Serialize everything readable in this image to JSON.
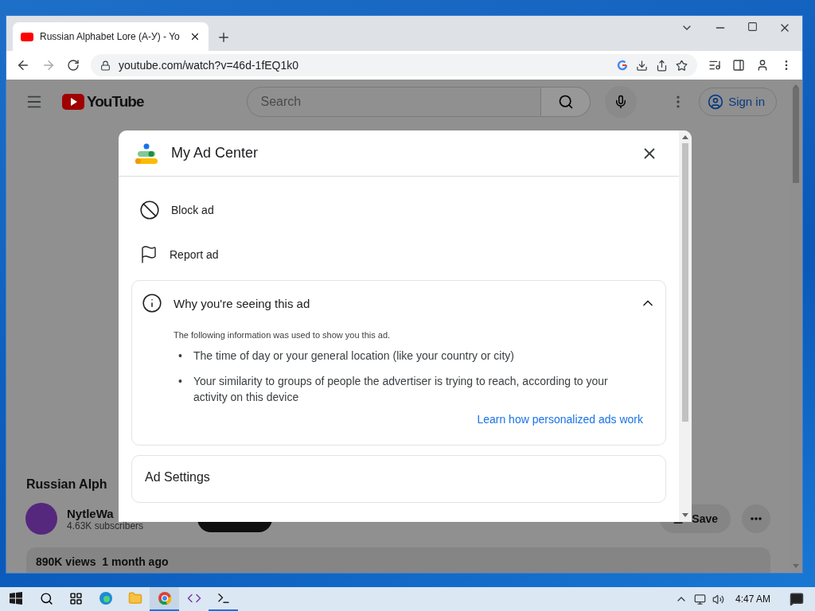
{
  "window": {
    "tab": {
      "title": "Russian Alphabet Lore (А-У) - Yo",
      "selected": true
    },
    "address": "youtube.com/watch?v=46d-1fEQ1k0"
  },
  "youtube": {
    "logo": "YouTube",
    "search": {
      "placeholder": "Search"
    },
    "sign_in": "Sign in",
    "video_title": "Russian Alph",
    "channel": {
      "name": "NytleWa",
      "subscribers": "4.63K subscribers"
    },
    "actions": [
      "Save"
    ],
    "description": "890K views  1 month ago"
  },
  "dialog": {
    "title": "My Ad Center",
    "items": [
      {
        "kind": "block",
        "label": "Block ad"
      },
      {
        "kind": "report",
        "label": "Report ad"
      }
    ],
    "why": {
      "title": "Why you're seeing this ad",
      "expanded": true,
      "intro": "The following information was used to show you this ad.",
      "bullets": [
        {
          "marker": "•",
          "text": "The time of day or your general location (like your country or city)"
        },
        {
          "marker": "•",
          "text": "Your similarity to groups of people the advertiser is trying to reach, according to your activity on this device"
        }
      ],
      "link": "Learn how personalized ads work"
    },
    "sections": [
      {
        "title": "Ad Settings"
      }
    ]
  },
  "taskbar": {
    "apps": [
      {
        "kind": "edge",
        "selected": false,
        "running": false
      },
      {
        "kind": "explorer",
        "selected": false,
        "running": false
      },
      {
        "kind": "chrome",
        "selected": true,
        "running": true
      },
      {
        "kind": "studio",
        "selected": false,
        "running": false
      },
      {
        "kind": "terminal",
        "selected": false,
        "running": true
      }
    ],
    "time": "4:47 AM"
  }
}
